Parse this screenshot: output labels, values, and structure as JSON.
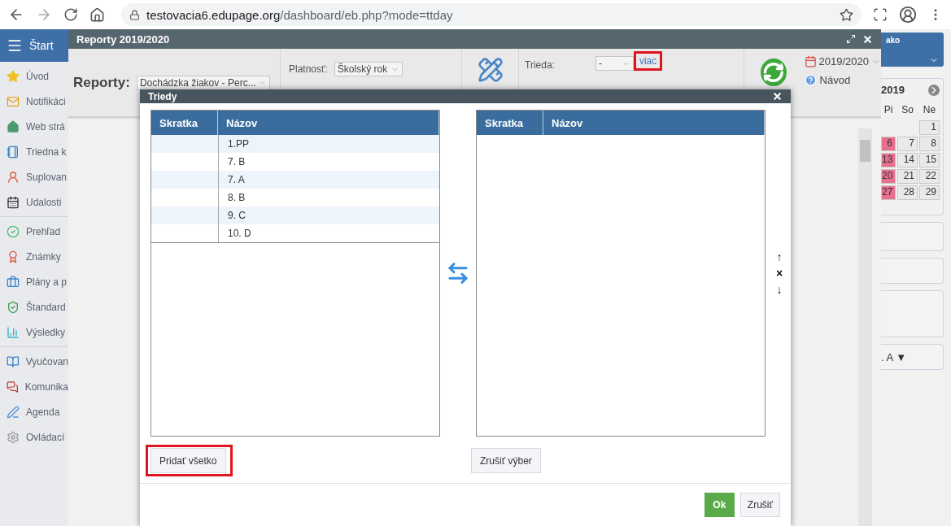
{
  "browser": {
    "url_host": "testovacia6.edupage.org",
    "url_path": "/dashboard/eb.php?mode=ttday"
  },
  "sidebar": {
    "header": "Štart",
    "groups": [
      [
        {
          "label": "Úvod"
        },
        {
          "label": "Notifikáci"
        },
        {
          "label": "Web strá"
        },
        {
          "label": "Triedna k"
        },
        {
          "label": "Suplovan"
        },
        {
          "label": "Udalosti"
        }
      ],
      [
        {
          "label": "Prehľad"
        },
        {
          "label": "Známky"
        },
        {
          "label": "Plány a p"
        },
        {
          "label": "Štandard"
        },
        {
          "label": "Výsledky"
        }
      ],
      [
        {
          "label": "Vyučovan"
        },
        {
          "label": "Komunika"
        },
        {
          "label": "Agenda"
        },
        {
          "label": "Ovládací"
        }
      ]
    ]
  },
  "user_box": {
    "text": "ako"
  },
  "calendar": {
    "year": "2019",
    "weekdays": [
      "Pi",
      "So",
      "Ne"
    ],
    "weeks": [
      [
        {
          "text": "1",
          "marked": false
        }
      ],
      [
        {
          "text": "6",
          "marked": true
        },
        {
          "text": "7",
          "marked": false
        },
        {
          "text": "8",
          "marked": false
        }
      ],
      [
        {
          "text": "13",
          "marked": true
        },
        {
          "text": "14",
          "marked": false
        },
        {
          "text": "15",
          "marked": false
        }
      ],
      [
        {
          "text": "20",
          "marked": true
        },
        {
          "text": "21",
          "marked": false
        },
        {
          "text": "22",
          "marked": false
        }
      ],
      [
        {
          "text": "27",
          "marked": true
        },
        {
          "text": "28",
          "marked": false
        },
        {
          "text": "29",
          "marked": false
        }
      ]
    ]
  },
  "class_picker": {
    "text": ". A",
    "arrow": "▼"
  },
  "reports_window": {
    "title": "Reporty 2019/2020",
    "label": "Reporty:",
    "report_select": "Dochádzka žiakov - Perc...",
    "validity_label": "Platnosť:",
    "validity_select": "Školský rok",
    "class_label": "Trieda:",
    "class_select": "-",
    "class_more_link": {
      "text": "viac",
      "highlighted": true
    },
    "year_select": "2019/2020",
    "help_link": "Návod"
  },
  "dialog": {
    "title": "Triedy",
    "left_table": {
      "columns": [
        "Skratka",
        "Názov"
      ],
      "rows": [
        {
          "name": "1.PP"
        },
        {
          "name": "7. B"
        },
        {
          "name": "7. A"
        },
        {
          "name": "8. B"
        },
        {
          "name": "9. C"
        },
        {
          "name": "10. D"
        }
      ]
    },
    "right_table": {
      "columns": [
        "Skratka",
        "Názov"
      ]
    },
    "order_controls": [
      "↑",
      "×",
      "↓"
    ],
    "add_all_button": {
      "label": "Pridať všetko",
      "highlighted": true
    },
    "clear_button": {
      "label": "Zrušiť výber"
    },
    "ok_button": "Ok",
    "cancel_button": "Zrušiť"
  }
}
